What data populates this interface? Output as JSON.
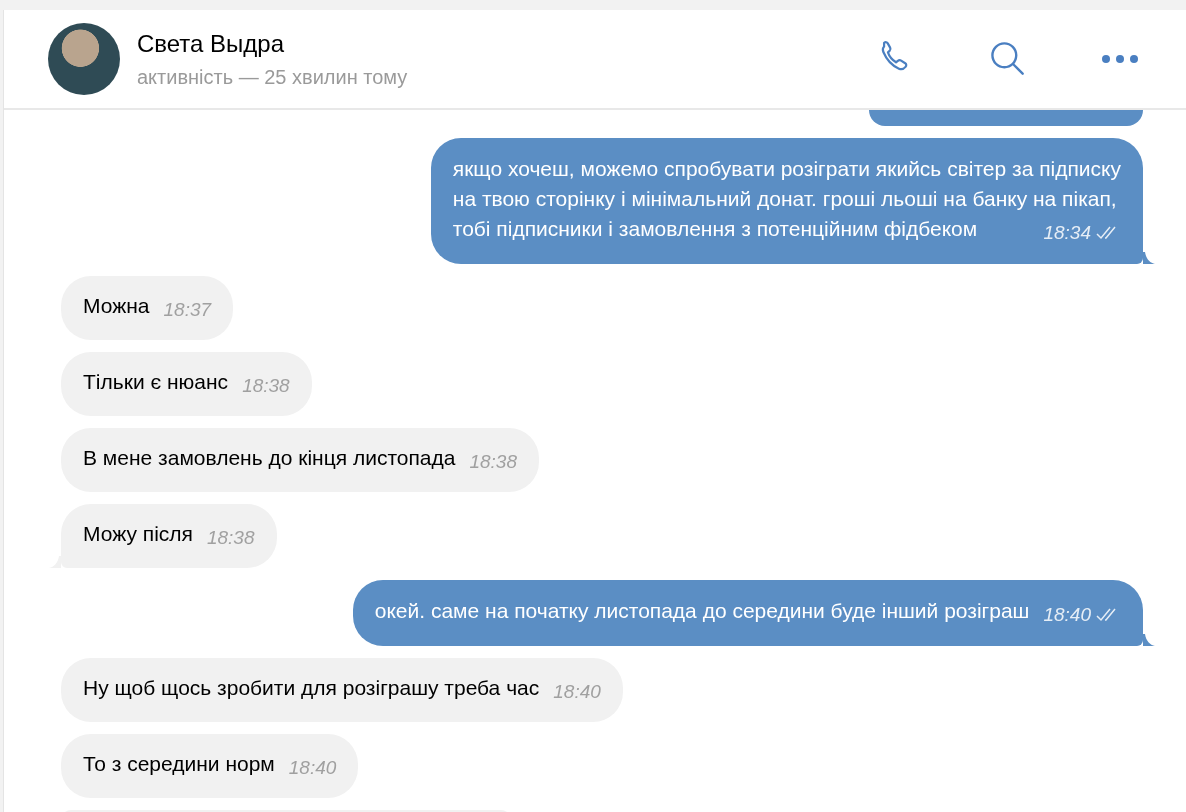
{
  "header": {
    "name": "Света Выдра",
    "status": "активність — 25 хвилин тому"
  },
  "messages": [
    {
      "kind": "out",
      "text": "якщо хочеш, можемо спробувати розіграти якийсь світер за підписку\nна твою сторінку і мінімальний донат. гроші льоші на банку на пікап,\nтобі підписники і замовлення з потенційним фідбеком",
      "time": "18:34",
      "read": true,
      "tail": true
    },
    {
      "kind": "in",
      "text": "Можна",
      "time": "18:37",
      "tail": false
    },
    {
      "kind": "in",
      "text": "Тільки є нюанс",
      "time": "18:38",
      "tail": false
    },
    {
      "kind": "in",
      "text": "В мене замовлень до кінця листопада",
      "time": "18:38",
      "tail": false
    },
    {
      "kind": "in",
      "text": "Можу після",
      "time": "18:38",
      "tail": true
    },
    {
      "kind": "out",
      "text": "окей. саме на початку листопада до середини буде інший розіграш",
      "time": "18:40",
      "read": true,
      "tail": true
    },
    {
      "kind": "in",
      "text": "Ну щоб щось зробити для розіграшу треба час",
      "time": "18:40",
      "tail": false
    },
    {
      "kind": "in",
      "text": "То з середини норм",
      "time": "18:40",
      "tail": false
    }
  ]
}
